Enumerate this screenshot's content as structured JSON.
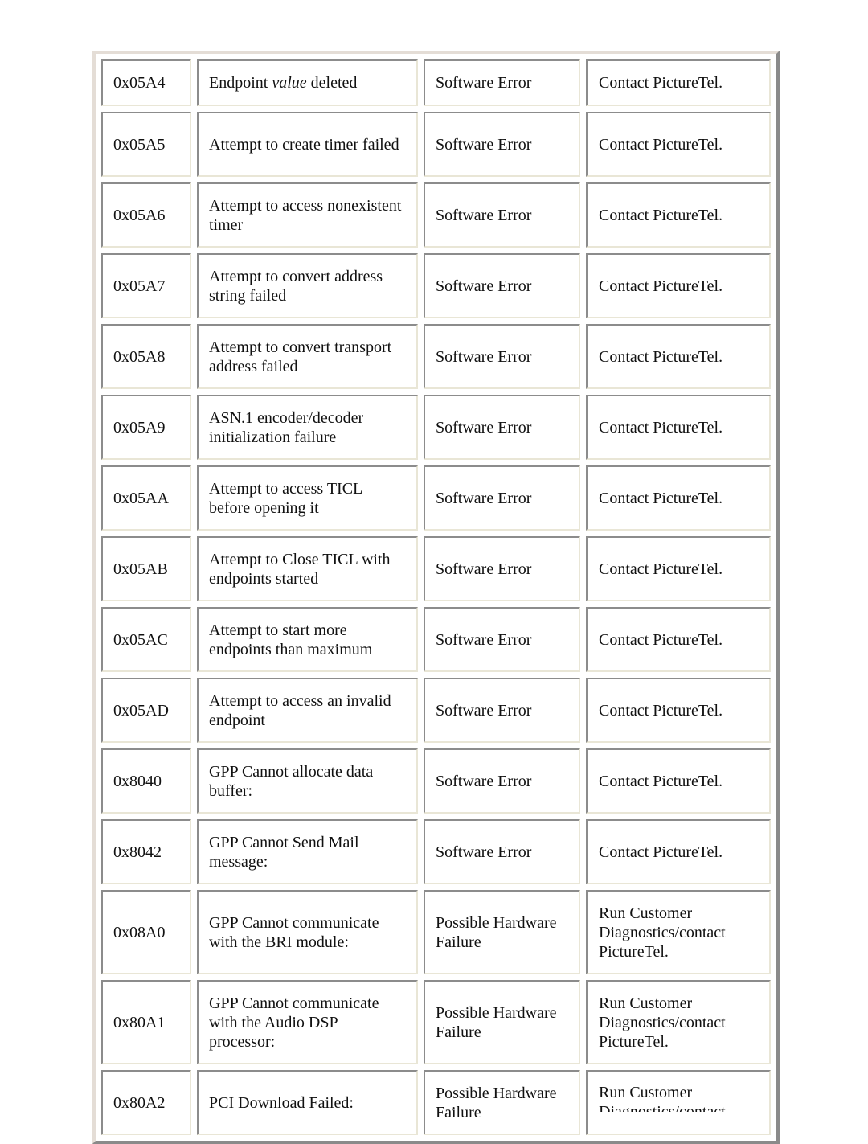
{
  "table": {
    "rows": [
      {
        "code": "0x05A4",
        "description_pre": "Endpoint ",
        "description_em": "value",
        "description_post": " deleted",
        "type": "Software Error",
        "action": "Contact PictureTel.",
        "height": "short"
      },
      {
        "code": "0x05A5",
        "description": "Attempt to create timer failed",
        "type": "Software Error",
        "action": "Contact PictureTel."
      },
      {
        "code": "0x05A6",
        "description": "Attempt to access nonexistent timer",
        "type": "Software Error",
        "action": "Contact PictureTel."
      },
      {
        "code": "0x05A7",
        "description": "Attempt to convert address string failed",
        "type": "Software Error",
        "action": "Contact PictureTel."
      },
      {
        "code": "0x05A8",
        "description": "Attempt to convert transport address failed",
        "type": "Software Error",
        "action": "Contact PictureTel."
      },
      {
        "code": "0x05A9",
        "description": "ASN.1 encoder/decoder initialization failure",
        "type": "Software Error",
        "action": "Contact PictureTel."
      },
      {
        "code": "0x05AA",
        "description": "Attempt to access TICL before opening it",
        "type": "Software Error",
        "action": "Contact PictureTel."
      },
      {
        "code": "0x05AB",
        "description": "Attempt to Close TICL with endpoints started",
        "type": "Software Error",
        "action": "Contact PictureTel."
      },
      {
        "code": "0x05AC",
        "description": "Attempt to start more endpoints than maximum",
        "type": "Software Error",
        "action": "Contact PictureTel."
      },
      {
        "code": "0x05AD",
        "description": "Attempt to access an invalid endpoint",
        "type": "Software Error",
        "action": "Contact PictureTel."
      },
      {
        "code": "0x8040",
        "description": "GPP Cannot allocate data buffer:",
        "type": "Software Error",
        "action": "Contact PictureTel."
      },
      {
        "code": "0x8042",
        "description": "GPP Cannot Send Mail message:",
        "type": "Software Error",
        "action": "Contact PictureTel."
      },
      {
        "code": "0x08A0",
        "description": "GPP Cannot communicate with the BRI module:",
        "type": "Possible Hardware Failure",
        "action": "Run Customer Diagnostics/contact PictureTel."
      },
      {
        "code": "0x80A1",
        "description": "GPP Cannot communicate with the Audio DSP processor:",
        "type": "Possible Hardware Failure",
        "action": "Run Customer Diagnostics/contact PictureTel."
      },
      {
        "code": "0x80A2",
        "description": "PCI Download Failed:",
        "type": "Possible Hardware Failure",
        "action": "Run Customer Diagnostics/contact PictureTel."
      }
    ]
  }
}
